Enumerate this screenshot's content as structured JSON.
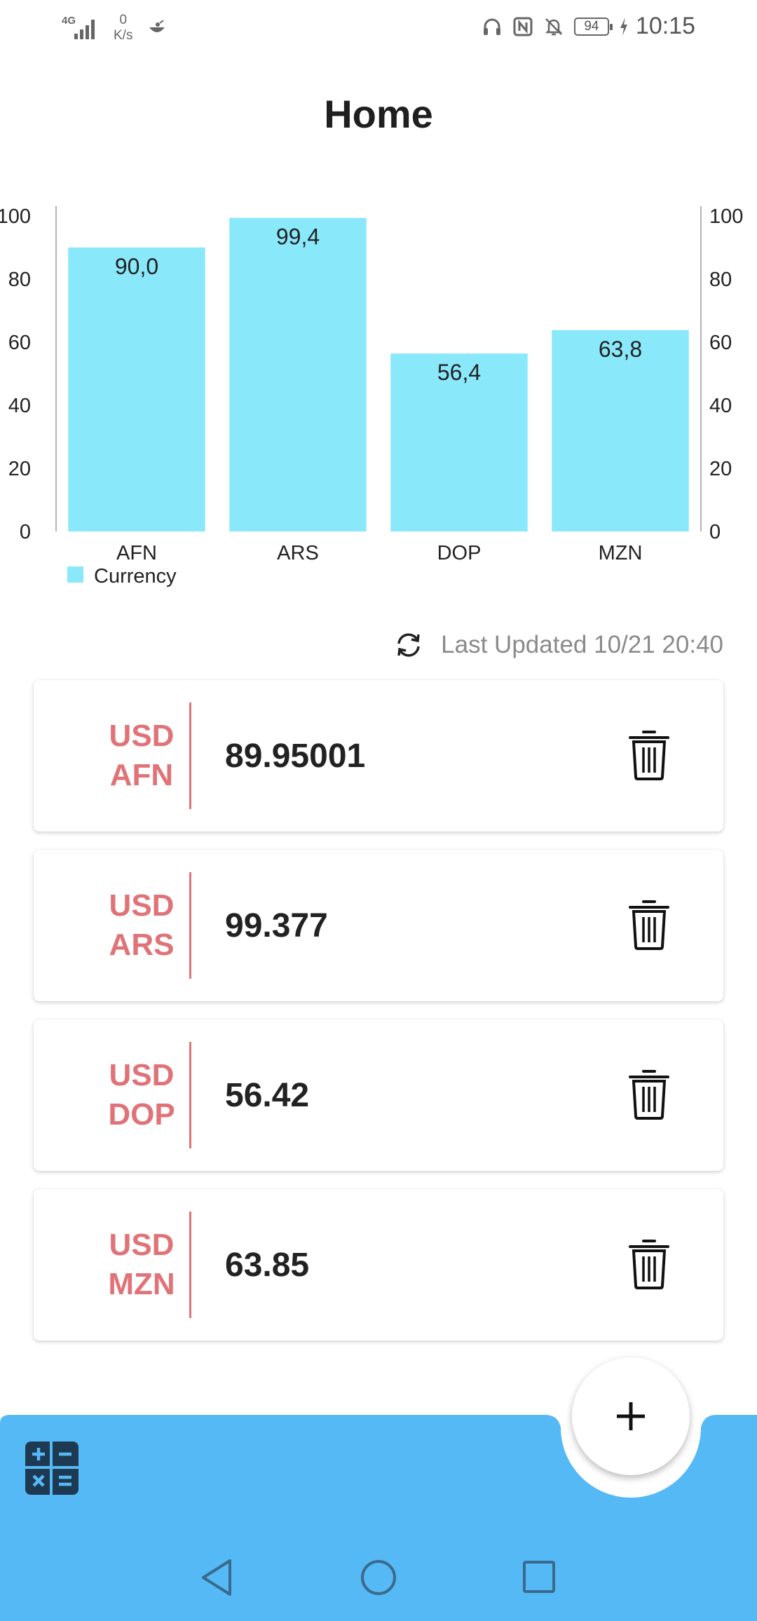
{
  "status_bar": {
    "network_type": "4G",
    "speed_value": "0",
    "speed_unit": "K/s",
    "battery": "94",
    "time": "10:15",
    "icons": [
      "signal-icon",
      "notification-app-icon",
      "headphones-icon",
      "nfc-icon",
      "bell-off-icon",
      "battery-icon",
      "charging-icon"
    ]
  },
  "header": {
    "title": "Home"
  },
  "chart_data": {
    "type": "bar",
    "categories": [
      "AFN",
      "ARS",
      "DOP",
      "MZN"
    ],
    "series": [
      {
        "name": "Currency",
        "values": [
          90.0,
          99.4,
          56.4,
          63.8
        ],
        "labels": [
          "90,0",
          "99,4",
          "56,4",
          "63,8"
        ]
      }
    ],
    "ylim": [
      0,
      100
    ],
    "yticks": [
      0,
      20,
      40,
      60,
      80,
      100
    ],
    "dual_y_axis": true,
    "bar_color": "#8AE8FB",
    "legend": {
      "position": "bottom-left"
    },
    "grid": false
  },
  "last_updated": {
    "text": "Last Updated 10/21 20:40"
  },
  "rates": [
    {
      "base": "USD",
      "quote": "AFN",
      "value": "89.95001"
    },
    {
      "base": "USD",
      "quote": "ARS",
      "value": "99.377"
    },
    {
      "base": "USD",
      "quote": "DOP",
      "value": "56.42"
    },
    {
      "base": "USD",
      "quote": "MZN",
      "value": "63.85"
    }
  ],
  "colors": {
    "accent": "#E07378",
    "bottom_bar": "#54B9F5",
    "calculator_icon": "#1E3A52"
  },
  "actions": {
    "fab_icon": "plus-icon",
    "calculator_icon": "calculator-icon"
  }
}
